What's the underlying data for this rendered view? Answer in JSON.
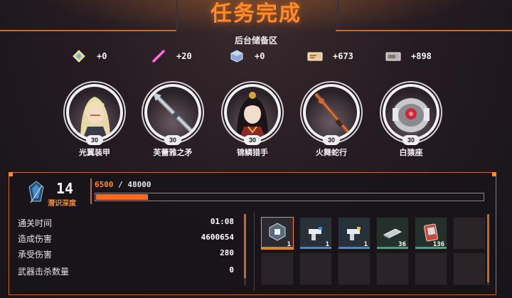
{
  "header": {
    "title": "任务完成",
    "subtitle": "后台储备区"
  },
  "resources": [
    {
      "icon": "diamond-crystal-icon",
      "value": "+0"
    },
    {
      "icon": "pink-stick-icon",
      "value": "+20"
    },
    {
      "icon": "blue-cube-icon",
      "value": "+0"
    },
    {
      "icon": "ticket-voucher-icon",
      "value": "+673"
    },
    {
      "icon": "gray-ticket-icon",
      "value": "+898"
    }
  ],
  "characters": [
    {
      "name": "光翼装甲",
      "level": "30",
      "icon": "blonde-pilot-portrait"
    },
    {
      "name": "芙蕾雅之矛",
      "level": "30",
      "icon": "spear-weapon-portrait"
    },
    {
      "name": "锦鳞猎手",
      "level": "30",
      "icon": "dark-hair-hunter-portrait"
    },
    {
      "name": "火舞蛇行",
      "level": "30",
      "icon": "serpent-blade-portrait"
    },
    {
      "name": "白猿座",
      "level": "30",
      "icon": "white-mech-portrait"
    }
  ],
  "progress": {
    "level": "14",
    "level_label": "潜识深度",
    "xp_current": "6500",
    "xp_separator": " / ",
    "xp_max": "48000",
    "xp_fraction": 0.135
  },
  "stats": [
    {
      "label": "通关时间",
      "value": "01:08"
    },
    {
      "label": "造成伤害",
      "value": "4600654"
    },
    {
      "label": "承受伤害",
      "value": "280"
    },
    {
      "label": "武器击杀数量",
      "value": "0"
    }
  ],
  "rewards": [
    {
      "icon": "chip-cube-icon",
      "count": "1",
      "rarity_color": "#c98a2a"
    },
    {
      "icon": "pistol-blue-icon",
      "count": "1",
      "rarity_color": "#3a8ad8"
    },
    {
      "icon": "pistol-gold-icon",
      "count": "1",
      "rarity_color": "#3a8ad8"
    },
    {
      "icon": "metal-bar-icon",
      "count": "36",
      "rarity_color": "#3aa87a"
    },
    {
      "icon": "card-pack-icon",
      "count": "136",
      "rarity_color": "#3aa87a"
    }
  ],
  "colors": {
    "accent": "#ff8a2a",
    "bg": "#1f1a20"
  }
}
